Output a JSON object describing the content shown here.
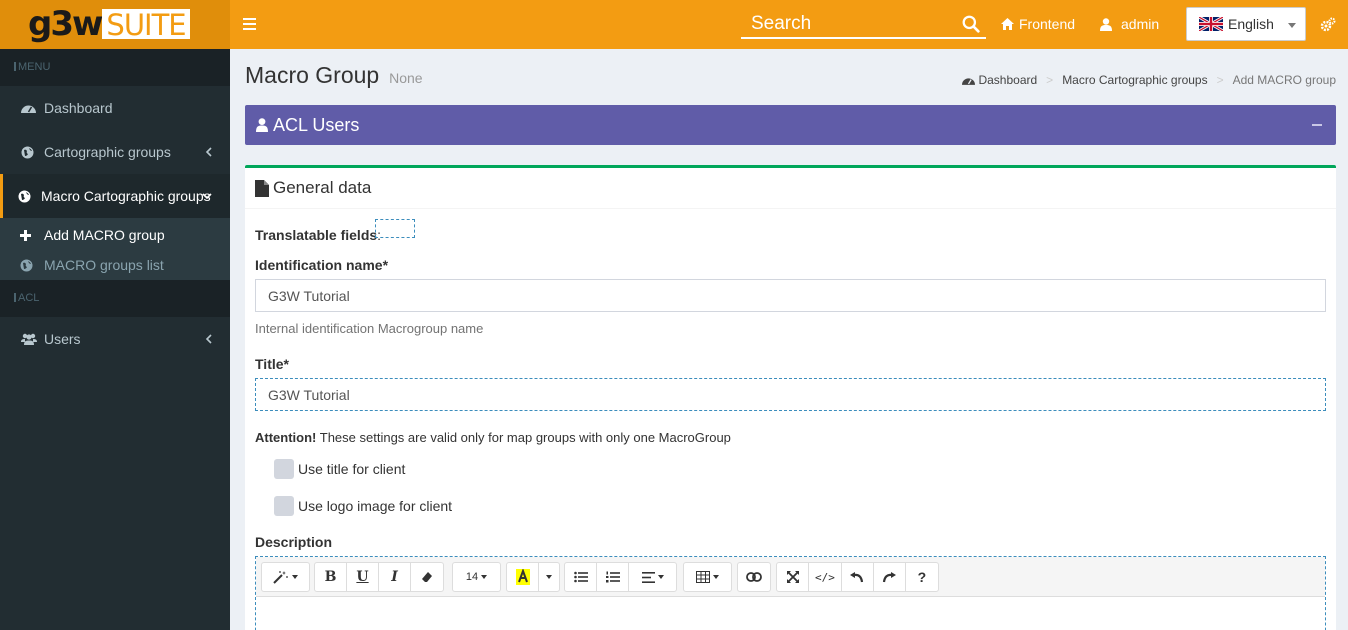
{
  "brand": {
    "logo_left": "g3w",
    "logo_right": "SUITE"
  },
  "topbar": {
    "search_placeholder": "Search",
    "frontend_label": "Frontend",
    "user_label": "admin",
    "language": "English"
  },
  "sidebar": {
    "menu_header": "MENU",
    "acl_header": "ACL",
    "items": [
      {
        "label": "Dashboard"
      },
      {
        "label": "Cartographic groups"
      },
      {
        "label": "Macro Cartographic groups"
      },
      {
        "label": "Users"
      }
    ],
    "submenu": [
      {
        "label": "Add MACRO group"
      },
      {
        "label": "MACRO groups list"
      }
    ]
  },
  "header": {
    "title": "Macro Group",
    "subtitle": "None",
    "breadcrumb": [
      "Dashboard",
      "Macro Cartographic groups",
      "Add MACRO group"
    ]
  },
  "acl_box": {
    "title": "ACL Users"
  },
  "form": {
    "box_title": "General data",
    "translatable_label": "Translatable fields",
    "identification_label": "Identification name*",
    "identification_value": "G3W Tutorial",
    "identification_help": "Internal identification Macrogroup name",
    "title_label": "Title*",
    "title_value": "G3W Tutorial",
    "attention_bold": "Attention!",
    "attention_text": "These settings are valid only for map groups with only one MacroGroup",
    "use_title_label": "Use title for client",
    "use_logo_label": "Use logo image for client",
    "description_label": "Description",
    "font_size": "14"
  },
  "colors": {
    "topbar": "#f39c12",
    "sidebar": "#222d32",
    "acl_box": "#605ca8",
    "general_border": "#00a65a"
  }
}
